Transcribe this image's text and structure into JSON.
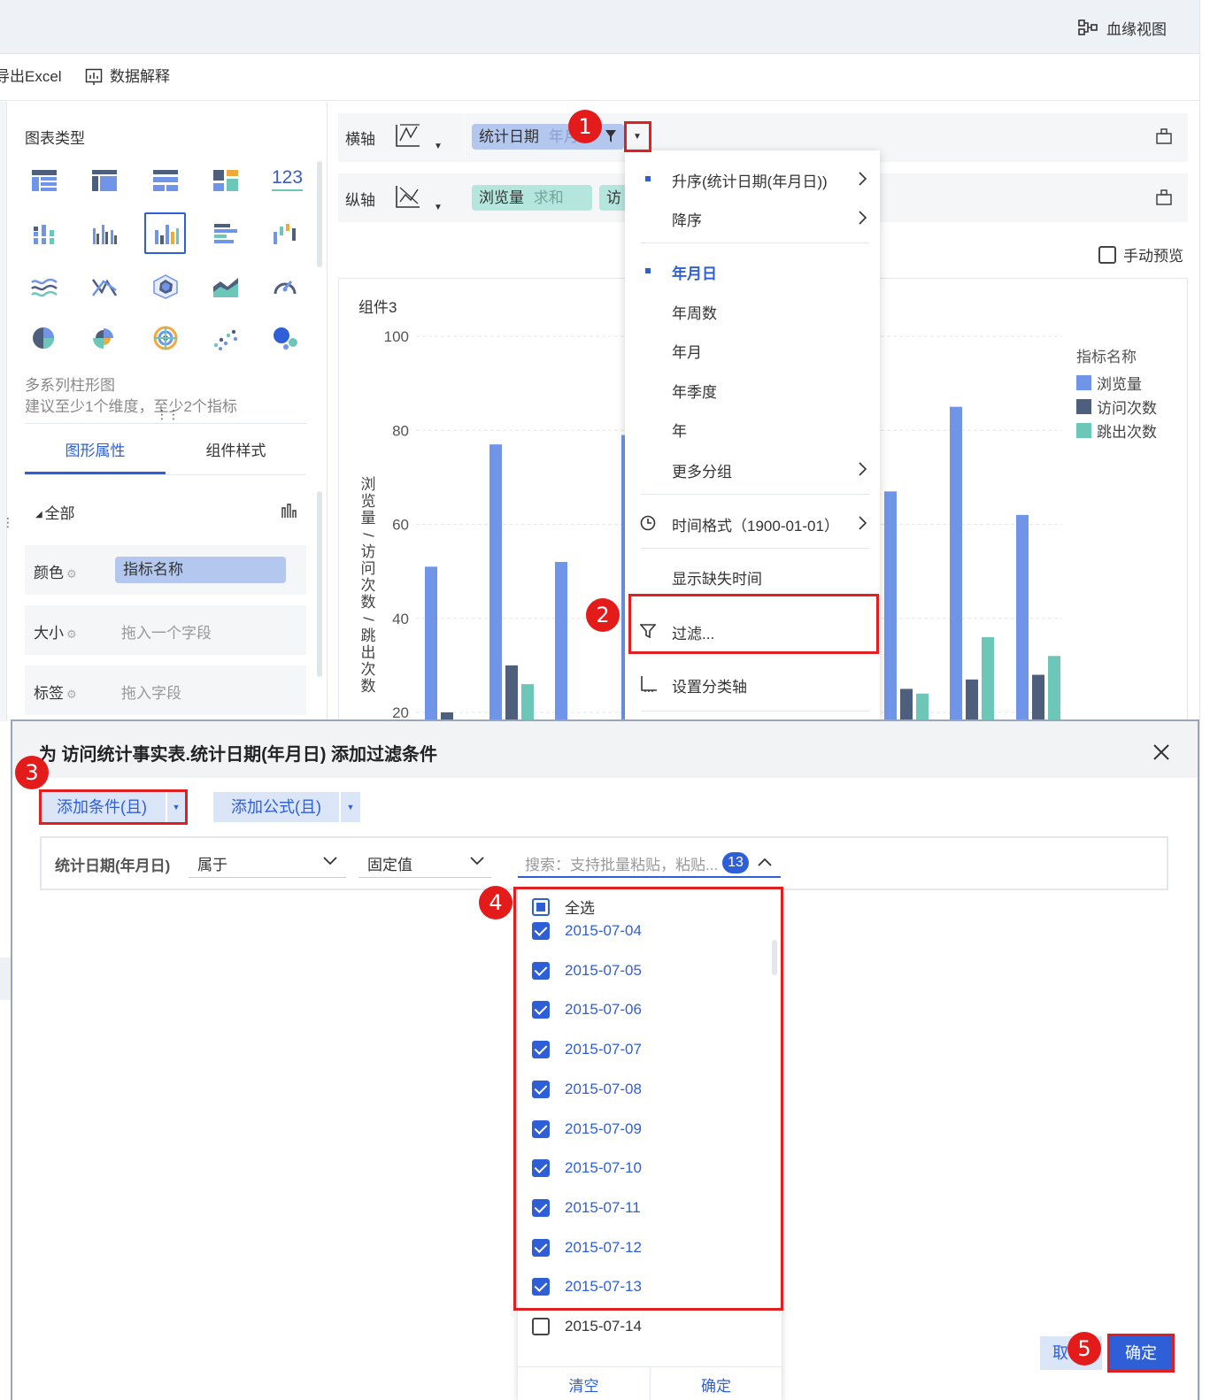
{
  "topbar": {
    "lineage_label": "血缘视图"
  },
  "toolbar": {
    "export_label": "导出Excel",
    "explain_label": "数据解释"
  },
  "left": {
    "chart_type_title": "图表类型",
    "count_icon_text": "123",
    "hint_title": "多系列柱形图",
    "hint_text": "建议至少1个维度，至少2个指标",
    "tabs": [
      "图形属性",
      "组件样式"
    ],
    "all_label": "全部",
    "color_label": "颜色",
    "color_value": "指标名称",
    "size_label": "大小",
    "size_placeholder": "拖入一个字段",
    "label_label": "标签",
    "label_placeholder": "拖入字段"
  },
  "axes": {
    "x_label": "横轴",
    "y_label": "纵轴",
    "x_field": "统计日期",
    "x_field_sub": "年月",
    "y_field": "浏览量",
    "y_field_sub": "求和",
    "y_field2": "访"
  },
  "manual_preview": "手动预览",
  "chart": {
    "component_title": "组件3",
    "ylabel": "浏览量/访问次数/跳出次数",
    "yticks": [
      "100",
      "80",
      "60",
      "40",
      "20"
    ],
    "legend_title": "指标名称",
    "colors": {
      "pv": "#7095e8",
      "visits": "#4e5f7e",
      "bounce": "#6cc7b8"
    }
  },
  "chart_data": {
    "type": "bar",
    "title": "组件3",
    "ylabel": "浏览量/访问次数/跳出次数",
    "ylim": [
      20,
      100
    ],
    "legend_position": "top-right",
    "series": [
      {
        "name": "浏览量",
        "values": [
          51,
          77,
          52,
          79,
          67,
          85,
          62
        ]
      },
      {
        "name": "访问次数",
        "values": [
          20,
          30,
          null,
          null,
          25,
          27,
          28
        ]
      },
      {
        "name": "跳出次数",
        "values": [
          null,
          26,
          null,
          null,
          24,
          36,
          32
        ]
      }
    ]
  },
  "menu": {
    "items": [
      {
        "label": "升序(统计日期(年月日))",
        "dot": true,
        "arrow": true
      },
      {
        "label": "降序",
        "dot": false,
        "arrow": true
      },
      {
        "label": "年月日",
        "dot": true,
        "arrow": false,
        "active": true
      },
      {
        "label": "年周数",
        "dot": false,
        "arrow": false
      },
      {
        "label": "年月",
        "dot": false,
        "arrow": false
      },
      {
        "label": "年季度",
        "dot": false,
        "arrow": false
      },
      {
        "label": "年",
        "dot": false,
        "arrow": false
      },
      {
        "label": "更多分组",
        "dot": false,
        "arrow": true
      },
      {
        "label": "时间格式（1900-01-01）",
        "dot": false,
        "arrow": true
      },
      {
        "label": "显示缺失时间",
        "dot": false,
        "arrow": false
      },
      {
        "label": "过滤...",
        "dot": false,
        "arrow": false
      },
      {
        "label": "设置分类轴",
        "dot": false,
        "arrow": false
      }
    ]
  },
  "dialog": {
    "title": "为 访问统计事实表.统计日期(年月日) 添加过滤条件",
    "add_condition": "添加条件(且)",
    "add_formula": "添加公式(且)",
    "field_name": "统计日期(年月日)",
    "operator": "属于",
    "value_type": "固定值",
    "search_placeholder": "搜索：支持批量粘贴，粘贴...",
    "selected_count": "13",
    "select_all": "全选",
    "options": [
      {
        "label": "2015-07-04",
        "checked": true
      },
      {
        "label": "2015-07-05",
        "checked": true
      },
      {
        "label": "2015-07-06",
        "checked": true
      },
      {
        "label": "2015-07-07",
        "checked": true
      },
      {
        "label": "2015-07-08",
        "checked": true
      },
      {
        "label": "2015-07-09",
        "checked": true
      },
      {
        "label": "2015-07-10",
        "checked": true
      },
      {
        "label": "2015-07-11",
        "checked": true
      },
      {
        "label": "2015-07-12",
        "checked": true
      },
      {
        "label": "2015-07-13",
        "checked": true
      },
      {
        "label": "2015-07-14",
        "checked": false
      }
    ],
    "clear_label": "清空",
    "list_ok_label": "确定",
    "cancel_label": "取",
    "ok_label": "确定"
  },
  "badges": [
    "1",
    "2",
    "3",
    "4",
    "5"
  ]
}
